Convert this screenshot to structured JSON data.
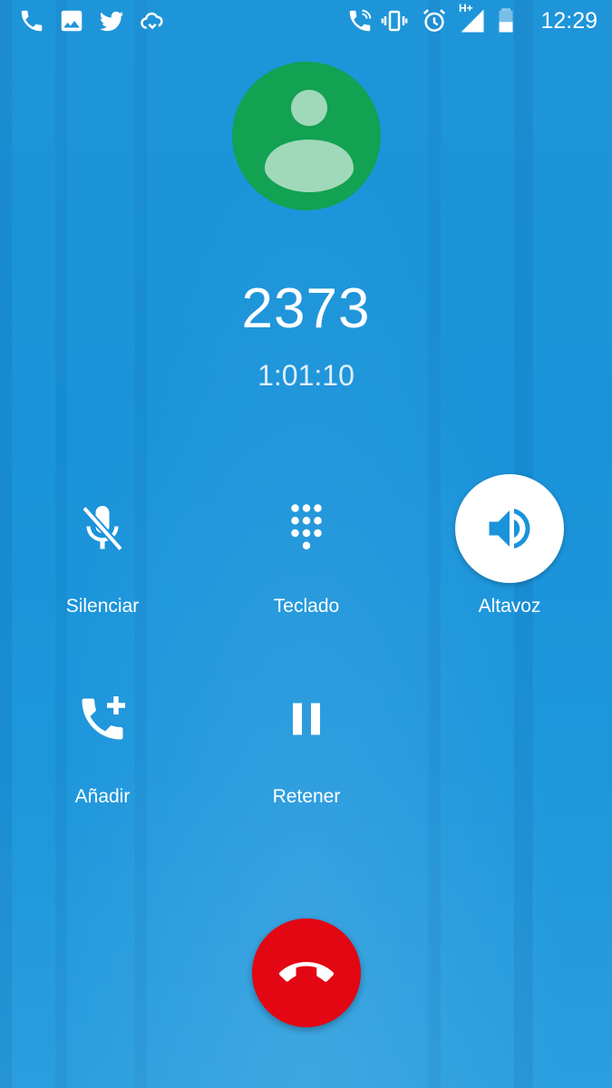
{
  "status_bar": {
    "time": "12:29",
    "network_label": "H+",
    "left_icons": [
      "phone-icon",
      "image-icon",
      "twitter-icon",
      "weather-icon"
    ],
    "right_icons": [
      "wifi-call-icon",
      "vibrate-icon",
      "alarm-icon",
      "signal-icon",
      "battery-icon"
    ]
  },
  "call": {
    "number": "2373",
    "duration": "1:01:10",
    "avatar_color": "#13a152"
  },
  "controls": {
    "mute": {
      "label": "Silenciar",
      "icon": "mic-off-icon",
      "active": false
    },
    "keypad": {
      "label": "Teclado",
      "icon": "dialpad-icon",
      "active": false
    },
    "speaker": {
      "label": "Altavoz",
      "icon": "speaker-icon",
      "active": true
    },
    "add_call": {
      "label": "Añadir",
      "icon": "add-call-icon",
      "active": false
    },
    "hold": {
      "label": "Retener",
      "icon": "pause-icon",
      "active": false
    }
  },
  "end_call": {
    "icon": "end-call-icon",
    "color": "#e30613"
  },
  "colors": {
    "background": "#1a93da",
    "accent": "#1a93da"
  }
}
